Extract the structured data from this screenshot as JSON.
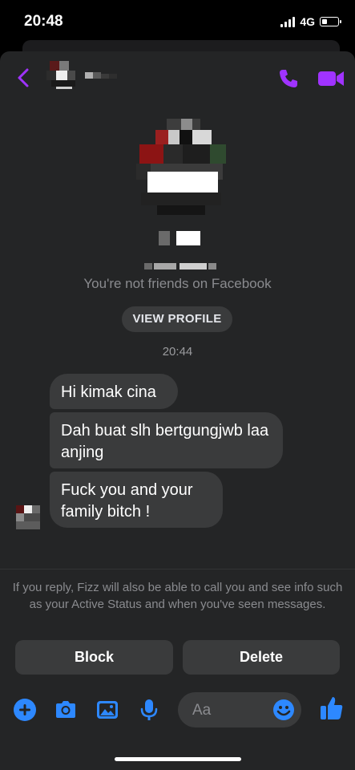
{
  "status_bar": {
    "time": "20:48",
    "network": "4G"
  },
  "conversation": {
    "not_friends_text": "You're not friends on Facebook",
    "view_profile_label": "VIEW PROFILE",
    "timestamp": "20:44",
    "messages": [
      {
        "text": "Hi kimak cina"
      },
      {
        "text": "Dah buat slh bertgungjwb laa anjing"
      },
      {
        "text": "Fuck you and your family bitch !"
      }
    ]
  },
  "request_notice": "If you reply, Fizz will also be able to call you and see info such as your Active Status and when you've seen messages.",
  "actions": {
    "block_label": "Block",
    "delete_label": "Delete"
  },
  "composer": {
    "placeholder": "Aa"
  },
  "colors": {
    "accent_purple": "#a033ff",
    "accent_blue": "#2d88ff",
    "bubble_gray": "#3a3b3c",
    "background": "#242526"
  },
  "icons": [
    "back-chevron-icon",
    "phone-icon",
    "video-camera-icon",
    "plus-circle-icon",
    "camera-icon",
    "image-icon",
    "microphone-icon",
    "emoji-icon",
    "thumbs-up-icon"
  ]
}
